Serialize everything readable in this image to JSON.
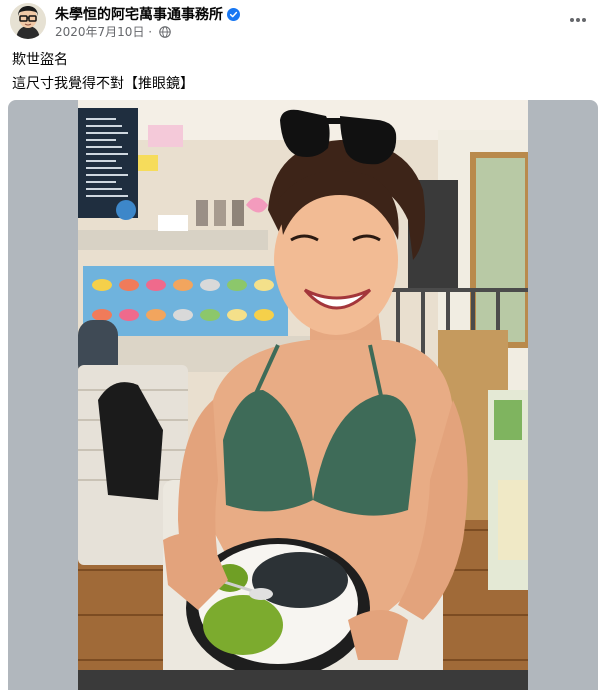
{
  "post": {
    "author": "朱學恒的阿宅萬事通事務所",
    "date": "2020年7月10日",
    "text_line1": "欺世盜名",
    "text_line2": "這尺寸我覺得不對【推眼鏡】"
  },
  "icons": {
    "verified": "verified-badge-icon",
    "audience": "globe-icon",
    "more": "more-options-icon"
  },
  "colors": {
    "verified": "#1877f2",
    "secondary_text": "#65676b",
    "media_background": "#b1b7bd",
    "menu_board": "#1f2e3f",
    "bikini": "#3e6b58"
  },
  "photo": {
    "menu_board_lines": [
      "",
      "",
      "",
      "",
      "",
      "",
      "",
      "",
      "",
      "",
      "",
      ""
    ],
    "menu_item_rows": [
      [
        "",
        "",
        "",
        "",
        "",
        "",
        ""
      ],
      [
        "",
        "",
        "",
        "",
        "",
        "",
        ""
      ]
    ]
  }
}
